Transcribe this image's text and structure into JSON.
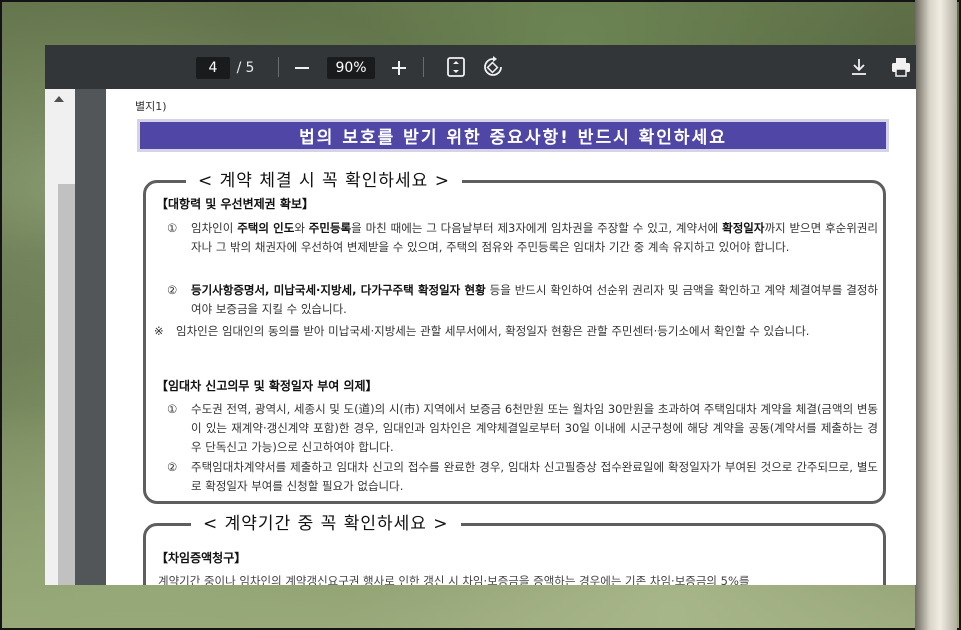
{
  "toolbar": {
    "current_page": "4",
    "page_separator": "/",
    "total_pages": "5",
    "zoom": "90%",
    "icons": [
      "zoom-out-icon",
      "zoom-in-icon",
      "fit-page-icon",
      "rotate-icon",
      "download-icon",
      "print-icon"
    ]
  },
  "document": {
    "annex_label": "별지1)",
    "banner": "법의 보호를 받기 위한 중요사항! 반드시 확인하세요",
    "box1": {
      "title": "< 계약 체결 시 꼭 확인하세요 >",
      "sec1_head": "【대항력 및 우선변제권 확보】",
      "item1": {
        "num": "①",
        "p1": "임차인이 ",
        "b1": "주택의 인도",
        "p2": "와 ",
        "b2": "주민등록",
        "p3": "을 마친 때에는 그 다음날부터 제3자에게 임차권을 주장할 수 있고, 계약서에 ",
        "b3": "확정일자",
        "p4": "까지 받으면 후순위권리자나 그 밖의 채권자에 우선하여 변제받을 수 있으며, 주택의 점유와 주민등록은 임대차 기간 중 계속 유지하고 있어야 합니다."
      },
      "item2": {
        "num": "②",
        "b1": "등기사항증명서, 미납국세·지방세, 다가구주택 확정일자 현황",
        "p1": " 등을 반드시 확인하여 선순위 권리자 및 금액을 확인하고 계약 체결여부를 결정하여야 보증금을 지킬 수 있습니다."
      },
      "note": {
        "num": "※",
        "text": "임차인은 임대인의 동의를 받아 미납국세·지방세는 관할 세무서에서, 확정일자 현황은 관할 주민센터·등기소에서 확인할 수 있습니다."
      },
      "sec2_head": "【임대차 신고의무 및 확정일자 부여 의제】",
      "item3": {
        "num": "①",
        "text": "수도권 전역, 광역시, 세종시 및 도(道)의 시(市) 지역에서 보증금 6천만원 또는 월차임 30만원을 초과하여 주택임대차 계약을 체결(금액의 변동이 있는 재계약·갱신계약 포함)한 경우, 임대인과 임차인은 계약체결일로부터 30일 이내에 시군구청에 해당 계약을 공동(계약서를 제출하는 경우 단독신고 가능)으로 신고하여야 합니다."
      },
      "item4": {
        "num": "②",
        "text": "주택임대차계약서를 제출하고 임대차 신고의 접수를 완료한 경우, 임대차 신고필증상 접수완료일에 확정일자가 부여된 것으로 간주되므로, 별도로 확정일자 부여를 신청할 필요가 없습니다."
      }
    },
    "box2": {
      "title": "< 계약기간 중 꼭 확인하세요 >",
      "sec_head": "【차임증액청구】",
      "cut_text": "계약기간 중이나 임차인의 계약갱신요구권 행사로 인한 갱신 시 차임·보증금을 증액하는 경우에는 기존 차임·보증금의 5%를"
    }
  },
  "colors": {
    "toolbar_bg": "#323639",
    "viewer_bg": "#525659",
    "banner_bg": "#4f46a6"
  }
}
